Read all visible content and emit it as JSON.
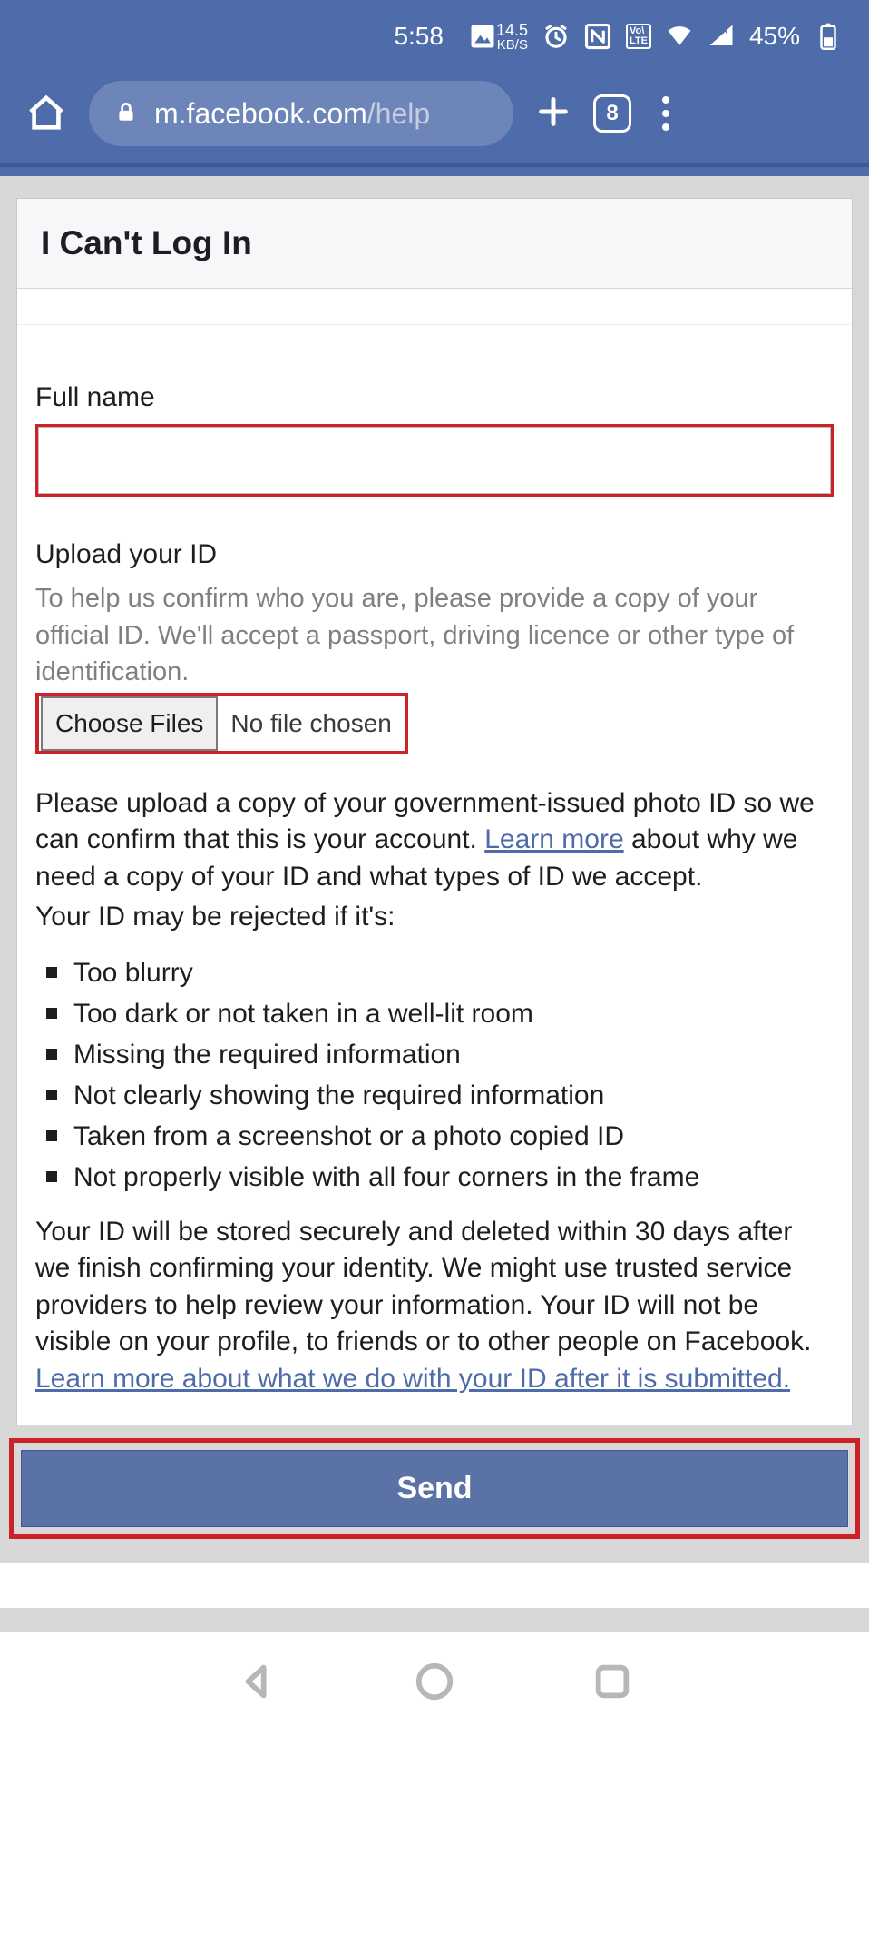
{
  "statusbar": {
    "clock": "5:58",
    "network_speed_value": "14.5",
    "network_speed_unit": "KB/S",
    "volte": "Vo LTE",
    "battery_percent": "45%"
  },
  "chrome": {
    "url_host": "m.facebook.com",
    "url_path": "/help",
    "tab_count": "8"
  },
  "page": {
    "title": "I Can't Log In",
    "full_name_label": "Full name",
    "full_name_value": "",
    "upload_label": "Upload your ID",
    "upload_help": "To help us confirm who you are, please provide a copy of your official ID. We'll accept a passport, driving licence or other type of identification.",
    "choose_files_label": "Choose Files",
    "no_file_chosen": "No file chosen",
    "para1_a": "Please upload a copy of your government-issued photo ID so we can confirm that this is your account. ",
    "para1_link": "Learn more",
    "para1_b": " about why we need a copy of your ID and what types of ID we accept.",
    "reject_intro": "Your ID may be rejected if it's:",
    "rejects": [
      "Too blurry",
      "Too dark or not taken in a well-lit room",
      "Missing the required information",
      "Not clearly showing the required information",
      "Taken from a screenshot or a photo copied ID",
      "Not properly visible with all four corners in the frame"
    ],
    "storage_para": "Your ID will be stored securely and deleted within 30 days after we finish confirming your identity. We might use trusted service providers to help review your information. Your ID will not be visible on your profile, to friends or to other people on Facebook.",
    "storage_link": "Learn more about what we do with your ID after it is submitted.",
    "send_label": "Send"
  }
}
